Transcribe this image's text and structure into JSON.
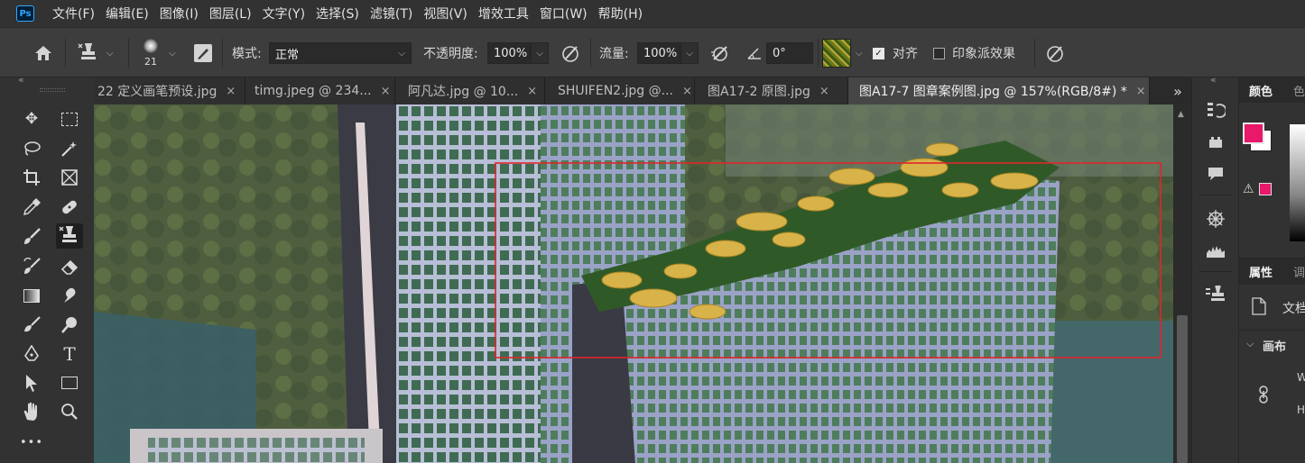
{
  "menubar": {
    "logo": "Ps",
    "items": [
      "文件(F)",
      "编辑(E)",
      "图像(I)",
      "图层(L)",
      "文字(Y)",
      "选择(S)",
      "滤镜(T)",
      "视图(V)",
      "增效工具",
      "窗口(W)",
      "帮助(H)"
    ]
  },
  "options": {
    "brush_size": "21",
    "mode_label": "模式:",
    "mode_value": "正常",
    "opacity_label": "不透明度:",
    "opacity_value": "100%",
    "flow_label": "流量:",
    "flow_value": "100%",
    "angle_value": "0°",
    "align_label": "对齐",
    "align_checked": true,
    "impressionist_label": "印象派效果",
    "impressionist_checked": false
  },
  "tabs": [
    {
      "label": "22 定义画笔预设.jpg",
      "close": "×",
      "active": false
    },
    {
      "label": "timg.jpeg @ 234...",
      "close": "×",
      "active": false
    },
    {
      "label": "阿凡达.jpg @ 10...",
      "close": "×",
      "active": false
    },
    {
      "label": "SHUIFEN2.jpg @...",
      "close": "×",
      "active": false
    },
    {
      "label": "图A17-2 原图.jpg",
      "close": "×",
      "active": false
    },
    {
      "label": "图A17-7 图章案例图.jpg @ 157%(RGB/8#) *",
      "close": "×",
      "active": true
    }
  ],
  "tabs_more": "»",
  "right_panel": {
    "color_tab": "颜色",
    "color_tab2": "色",
    "properties_tab": "属性",
    "properties_tab2": "调",
    "document_label": "文档",
    "canvas_section": "画布",
    "w_label": "W",
    "h_label": "H",
    "foreground_color": "#e8186a",
    "background_color": "#ffffff"
  },
  "tools": {
    "more": "•••"
  },
  "colors": {
    "selection_rect": "#e0262b",
    "accent": "#31a8ff"
  }
}
